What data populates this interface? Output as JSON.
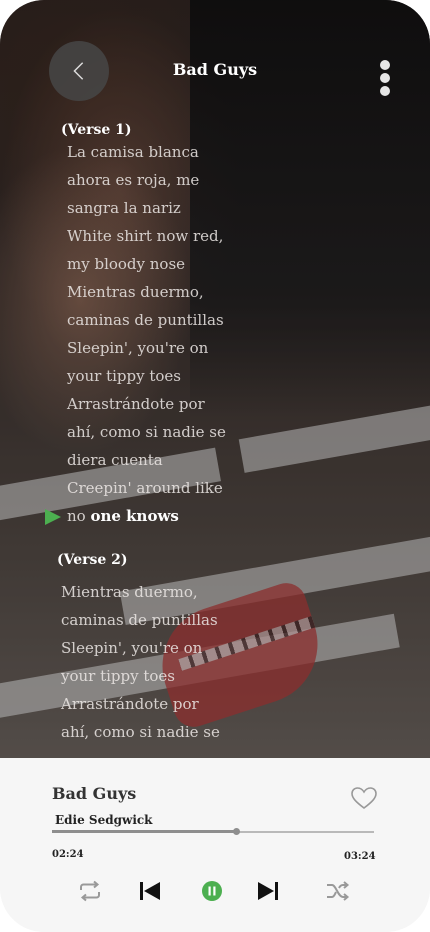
{
  "header": {
    "title": "Bad Guys",
    "back_icon": "chevron-left-icon",
    "more_icon": "more-vertical-icon"
  },
  "lyrics": {
    "verses": [
      {
        "label": "(Verse 1)",
        "lines": [
          "La camisa blanca",
          "ahora es roja, me",
          "sangra la nariz",
          "White shirt now red,",
          "my bloody nose",
          "Mientras duermo,",
          "caminas de puntillas",
          "Sleepin', you're on",
          "your tippy toes",
          "Arrastrándote por",
          "ahí, como si nadie se",
          "diera cuenta",
          "Creepin' around like"
        ],
        "current_line_prefix": "no ",
        "current_line_highlight": "one knows"
      },
      {
        "label": "(Verse 2)",
        "lines": [
          "Mientras duermo,",
          "caminas de puntillas",
          "Sleepin', you're on",
          "your tippy toes",
          "Arrastrándote por",
          "ahí, como si nadie se"
        ]
      }
    ],
    "current_marker_icon": "play-triangle-icon",
    "marker_color": "#4caf50"
  },
  "player": {
    "song_title": "Bad Guys",
    "artist": "Edie Sedgwick",
    "elapsed": "02:24",
    "total": "03:24",
    "progress": 0.57,
    "favorite_icon": "heart-outline-icon",
    "controls": {
      "repeat_icon": "repeat-icon",
      "previous_icon": "skip-previous-icon",
      "play_pause_icon": "pause-circle-icon",
      "next_icon": "skip-next-icon",
      "shuffle_icon": "shuffle-icon"
    },
    "accent_color": "#4caf50"
  }
}
